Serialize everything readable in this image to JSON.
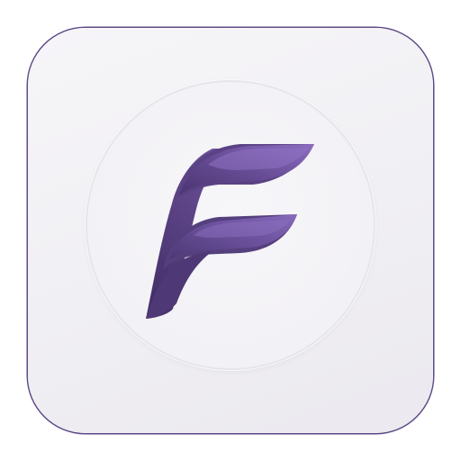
{
  "app_icon": {
    "logo_icon": "letter-f-logo-icon",
    "colors": {
      "background": "#f2f1f5",
      "border": "#5e4a86",
      "logo_dark": "#4b3571",
      "logo_mid": "#6b4f9a",
      "logo_light": "#8a6bbd"
    }
  }
}
